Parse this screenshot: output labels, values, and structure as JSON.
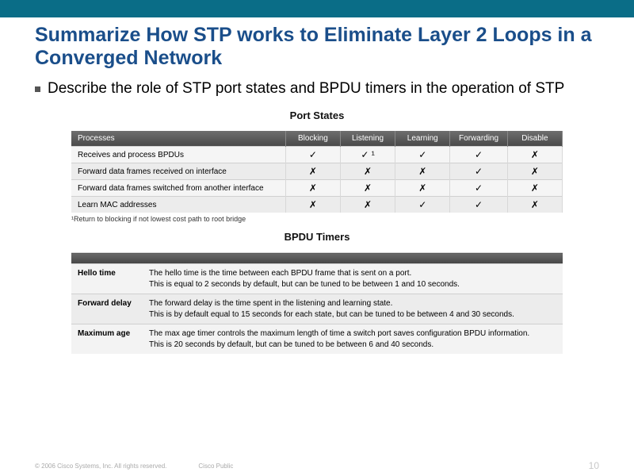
{
  "title": "Summarize How STP works to Eliminate Layer 2 Loops in a Converged Network",
  "bullet": "Describe the role of STP port states and BPDU timers in the operation of STP",
  "portStates": {
    "caption": "Port States",
    "headers": [
      "Processes",
      "Blocking",
      "Listening",
      "Learning",
      "Forwarding",
      "Disable"
    ],
    "rows": [
      {
        "label": "Receives and process BPDUs",
        "cells": [
          "✓",
          "✓ ¹",
          "✓",
          "✓",
          "✗"
        ]
      },
      {
        "label": "Forward data frames received on interface",
        "cells": [
          "✗",
          "✗",
          "✗",
          "✓",
          "✗"
        ]
      },
      {
        "label": "Forward data frames switched from another interface",
        "cells": [
          "✗",
          "✗",
          "✗",
          "✓",
          "✗"
        ]
      },
      {
        "label": "Learn MAC addresses",
        "cells": [
          "✗",
          "✗",
          "✓",
          "✓",
          "✗"
        ]
      }
    ],
    "footnote": "¹Return to blocking if not lowest cost path to root bridge"
  },
  "bpduTimers": {
    "caption": "BPDU Timers",
    "rows": [
      {
        "label": "Hello time",
        "text": "The hello time is the time between each BPDU frame that is sent on a port.\nThis is equal to 2 seconds by default, but can be tuned to be between 1 and 10 seconds."
      },
      {
        "label": "Forward delay",
        "text": "The forward delay is the time spent in the listening and learning state.\nThis is by default equal to 15 seconds for each state, but can be tuned to be between 4 and 30 seconds."
      },
      {
        "label": "Maximum age",
        "text": "The max age timer controls the maximum length of time a switch port saves configuration BPDU information.\nThis is 20 seconds by default, but can be tuned to be between 6 and 40 seconds."
      }
    ]
  },
  "footer": {
    "copyright": "© 2006 Cisco Systems, Inc. All rights reserved.",
    "label": "Cisco Public",
    "page": "10"
  }
}
